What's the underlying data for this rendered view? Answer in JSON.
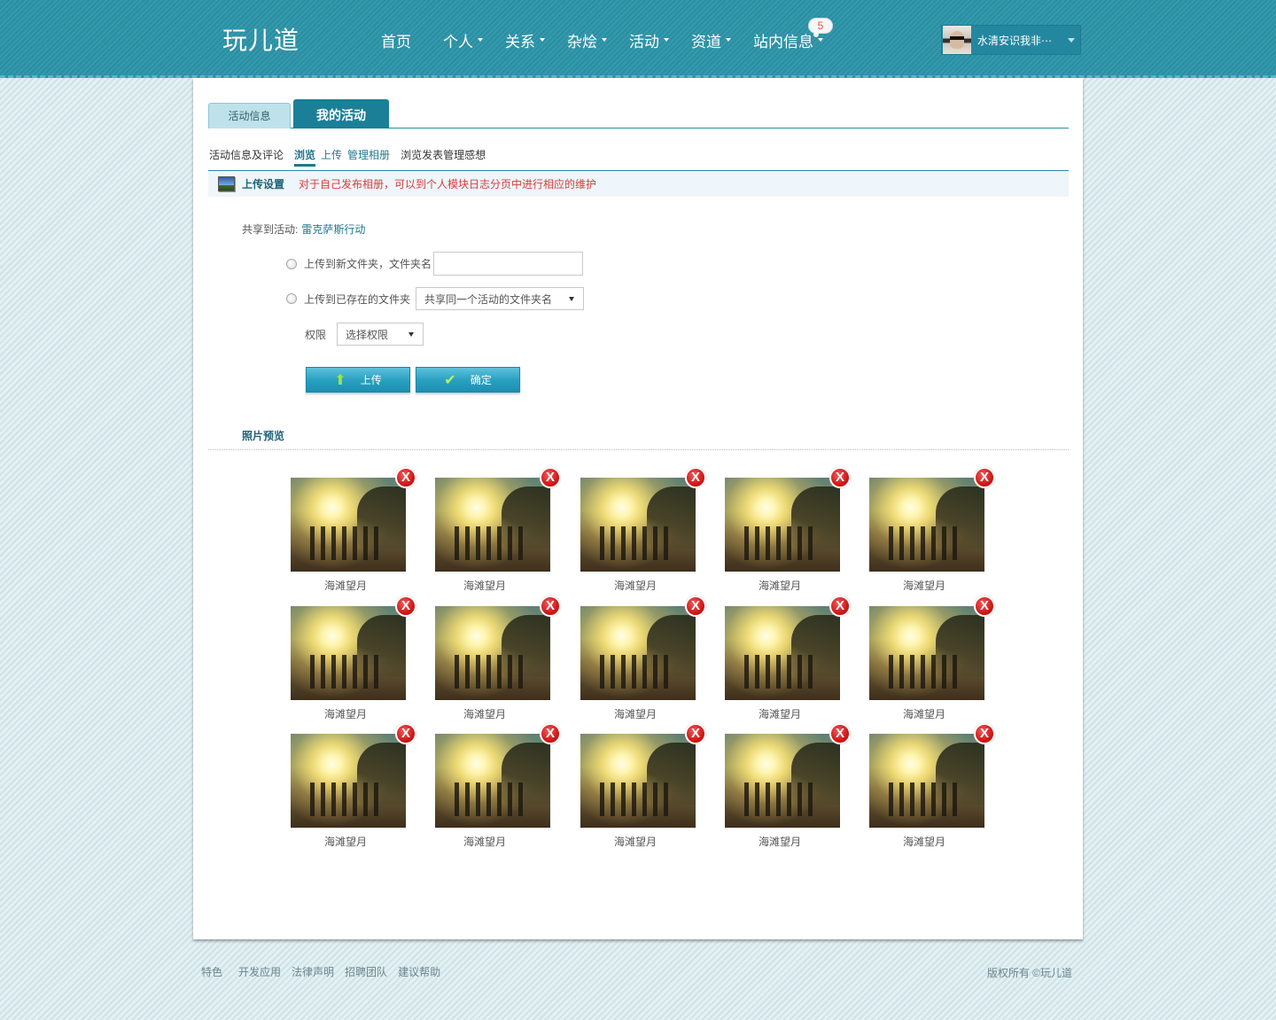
{
  "header": {
    "logo": "玩儿道",
    "nav": [
      {
        "label": "首页",
        "dropdown": false
      },
      {
        "label": "个人",
        "dropdown": true
      },
      {
        "label": "关系",
        "dropdown": true
      },
      {
        "label": "杂烩",
        "dropdown": true
      },
      {
        "label": "活动",
        "dropdown": true
      },
      {
        "label": "资道",
        "dropdown": true
      },
      {
        "label": "站内信息",
        "dropdown": true
      }
    ],
    "message_count": "5",
    "user_name": "水清安识我非⋯"
  },
  "tabs": {
    "activity_info": "活动信息",
    "my_activity": "我的活动"
  },
  "subnav": {
    "comments": "活动信息及评论",
    "browse": "浏览",
    "upload": "上传",
    "manage_album": "管理相册",
    "thoughts": "浏览发表管理感想"
  },
  "upload_settings": {
    "title": "上传设置",
    "note": "对于自己发布相册，可以到个人模块日志分页中进行相应的维护"
  },
  "form": {
    "share_label": "共享到活动:",
    "share_activity": "雷克萨斯行动",
    "new_folder_label": "上传到新文件夹，文件夹名",
    "new_folder_value": "",
    "existing_folder_label": "上传到已存在的文件夹",
    "existing_folder_selected": "共享同一个活动的文件夹名",
    "permission_label": "权限",
    "permission_selected": "选择权限",
    "upload_button": "上传",
    "confirm_button": "确定"
  },
  "preview": {
    "title": "照片预览",
    "photos": [
      {
        "caption": "海滩望月"
      },
      {
        "caption": "海滩望月"
      },
      {
        "caption": "海滩望月"
      },
      {
        "caption": "海滩望月"
      },
      {
        "caption": "海滩望月"
      },
      {
        "caption": "海滩望月"
      },
      {
        "caption": "海滩望月"
      },
      {
        "caption": "海滩望月"
      },
      {
        "caption": "海滩望月"
      },
      {
        "caption": "海滩望月"
      },
      {
        "caption": "海滩望月"
      },
      {
        "caption": "海滩望月"
      },
      {
        "caption": "海滩望月"
      },
      {
        "caption": "海滩望月"
      },
      {
        "caption": "海滩望月"
      }
    ],
    "delete_glyph": "X"
  },
  "footer": {
    "links": [
      "特色",
      "开发应用",
      "法律声明",
      "招聘团队",
      "建议帮助"
    ],
    "copyright": "版权所有 ©玩儿道"
  },
  "colors": {
    "header": "#2b93a8",
    "accent": "#1f7890",
    "note_red": "#d83c3c",
    "button": "#2aa1c2"
  }
}
